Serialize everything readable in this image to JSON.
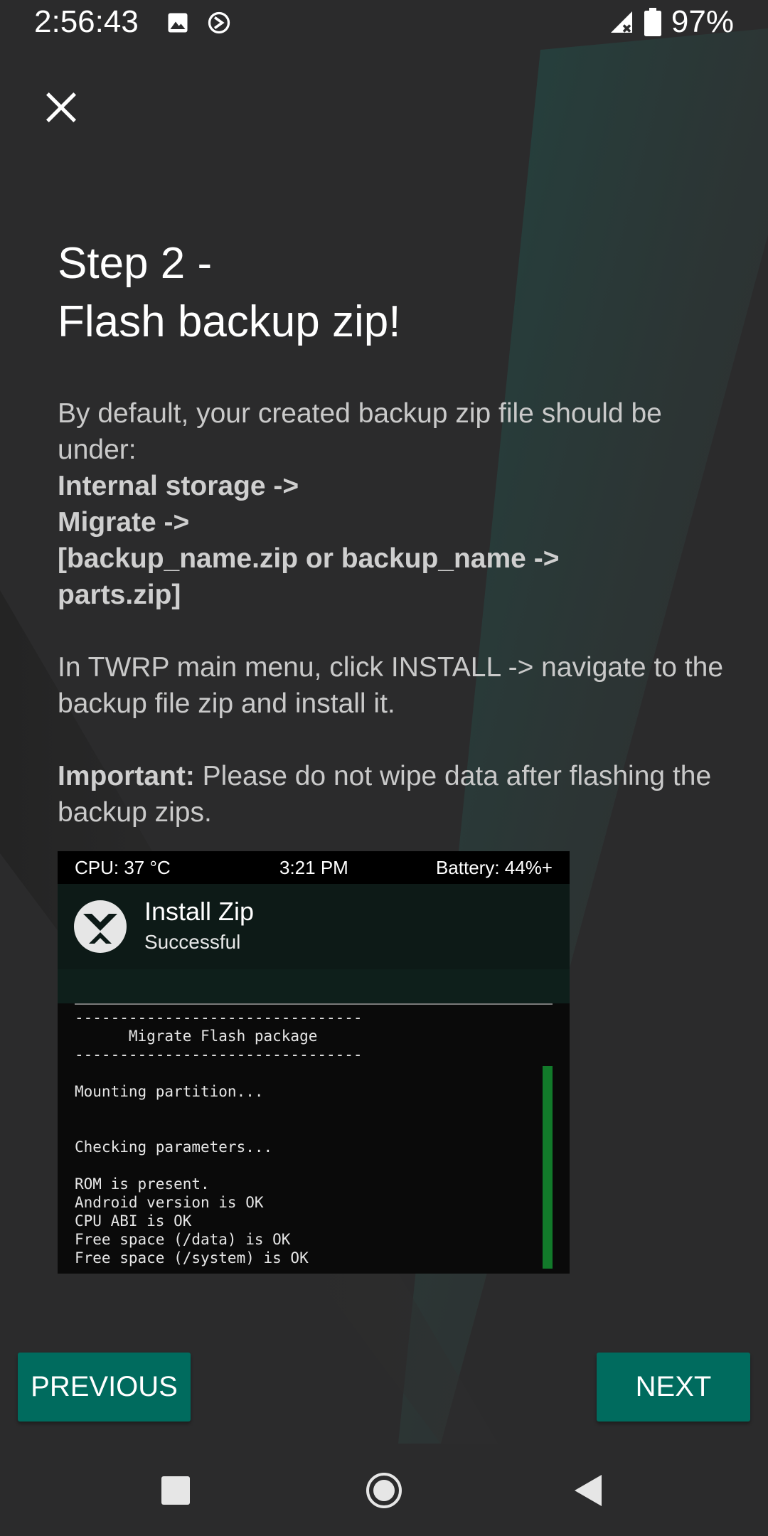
{
  "status_bar": {
    "time": "2:56:43",
    "battery": "97%",
    "icons": [
      "image-icon",
      "sync-icon",
      "signal-no-data-icon",
      "battery-icon"
    ]
  },
  "close_icon": "close-icon",
  "title_line1": "Step 2 -",
  "title_line2": "Flash backup zip!",
  "paragraph1": {
    "intro": " By default, your created backup zip file should be under:",
    "path_line1": " Internal storage ->",
    "path_line2": "Migrate ->",
    "path_line3": "[backup_name.zip or backup_name ->",
    "path_line4": "parts.zip]"
  },
  "paragraph2": " In TWRP main menu, click INSTALL -> navigate to the backup file zip and install it.",
  "paragraph3": {
    "label": " Important:",
    "text": " Please do not wipe data after flashing the backup zips."
  },
  "twrp_screenshot": {
    "cpu": "CPU: 37 °C",
    "clock": "3:21 PM",
    "battery": "Battery: 44%+",
    "header_title": "Install Zip",
    "header_subtitle": "Successful",
    "console_lines": [
      "--------------------------------",
      "      Migrate Flash package",
      "--------------------------------",
      "",
      "Mounting partition...",
      "",
      "",
      "Checking parameters...",
      "",
      "ROM is present.",
      "Android version is OK",
      "CPU ABI is OK",
      "Free space (/data) is OK",
      "Free space (/system) is OK"
    ],
    "accent_color": "#127a2a"
  },
  "buttons": {
    "previous": "PREVIOUS",
    "next": "NEXT",
    "color": "#006b5e"
  },
  "nav_bar": {
    "icons": [
      "recents-icon",
      "home-icon",
      "back-icon"
    ]
  }
}
